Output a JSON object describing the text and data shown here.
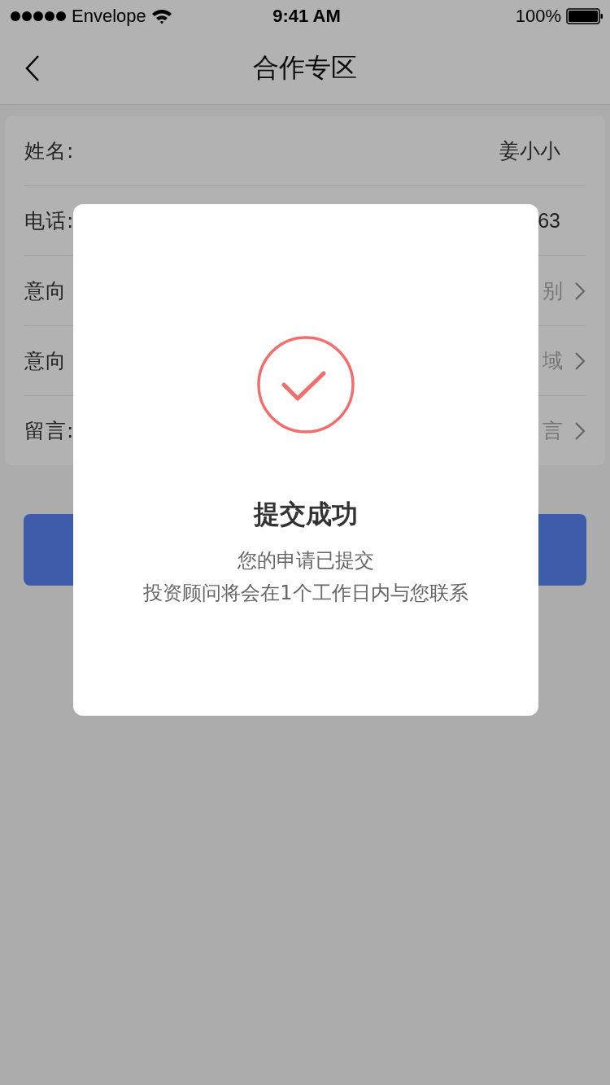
{
  "status_bar": {
    "carrier": "Envelope",
    "time": "9:41 AM",
    "battery": "100%"
  },
  "nav": {
    "title": "合作专区"
  },
  "form": {
    "rows": [
      {
        "kind": "text",
        "label": "姓名:",
        "value": "姜小小"
      },
      {
        "kind": "text",
        "label": "电话:",
        "value": "63"
      },
      {
        "kind": "select",
        "label": "意向",
        "placeholder": "别"
      },
      {
        "kind": "select",
        "label": "意向",
        "placeholder": "域"
      },
      {
        "kind": "select",
        "label": "留言:",
        "placeholder": "言"
      }
    ]
  },
  "submit": {
    "kind": "button"
  },
  "dialog": {
    "title": "提交成功",
    "lines": [
      "您的申请已提交",
      "投资顾问将会在1个工作日内与您联系"
    ]
  }
}
